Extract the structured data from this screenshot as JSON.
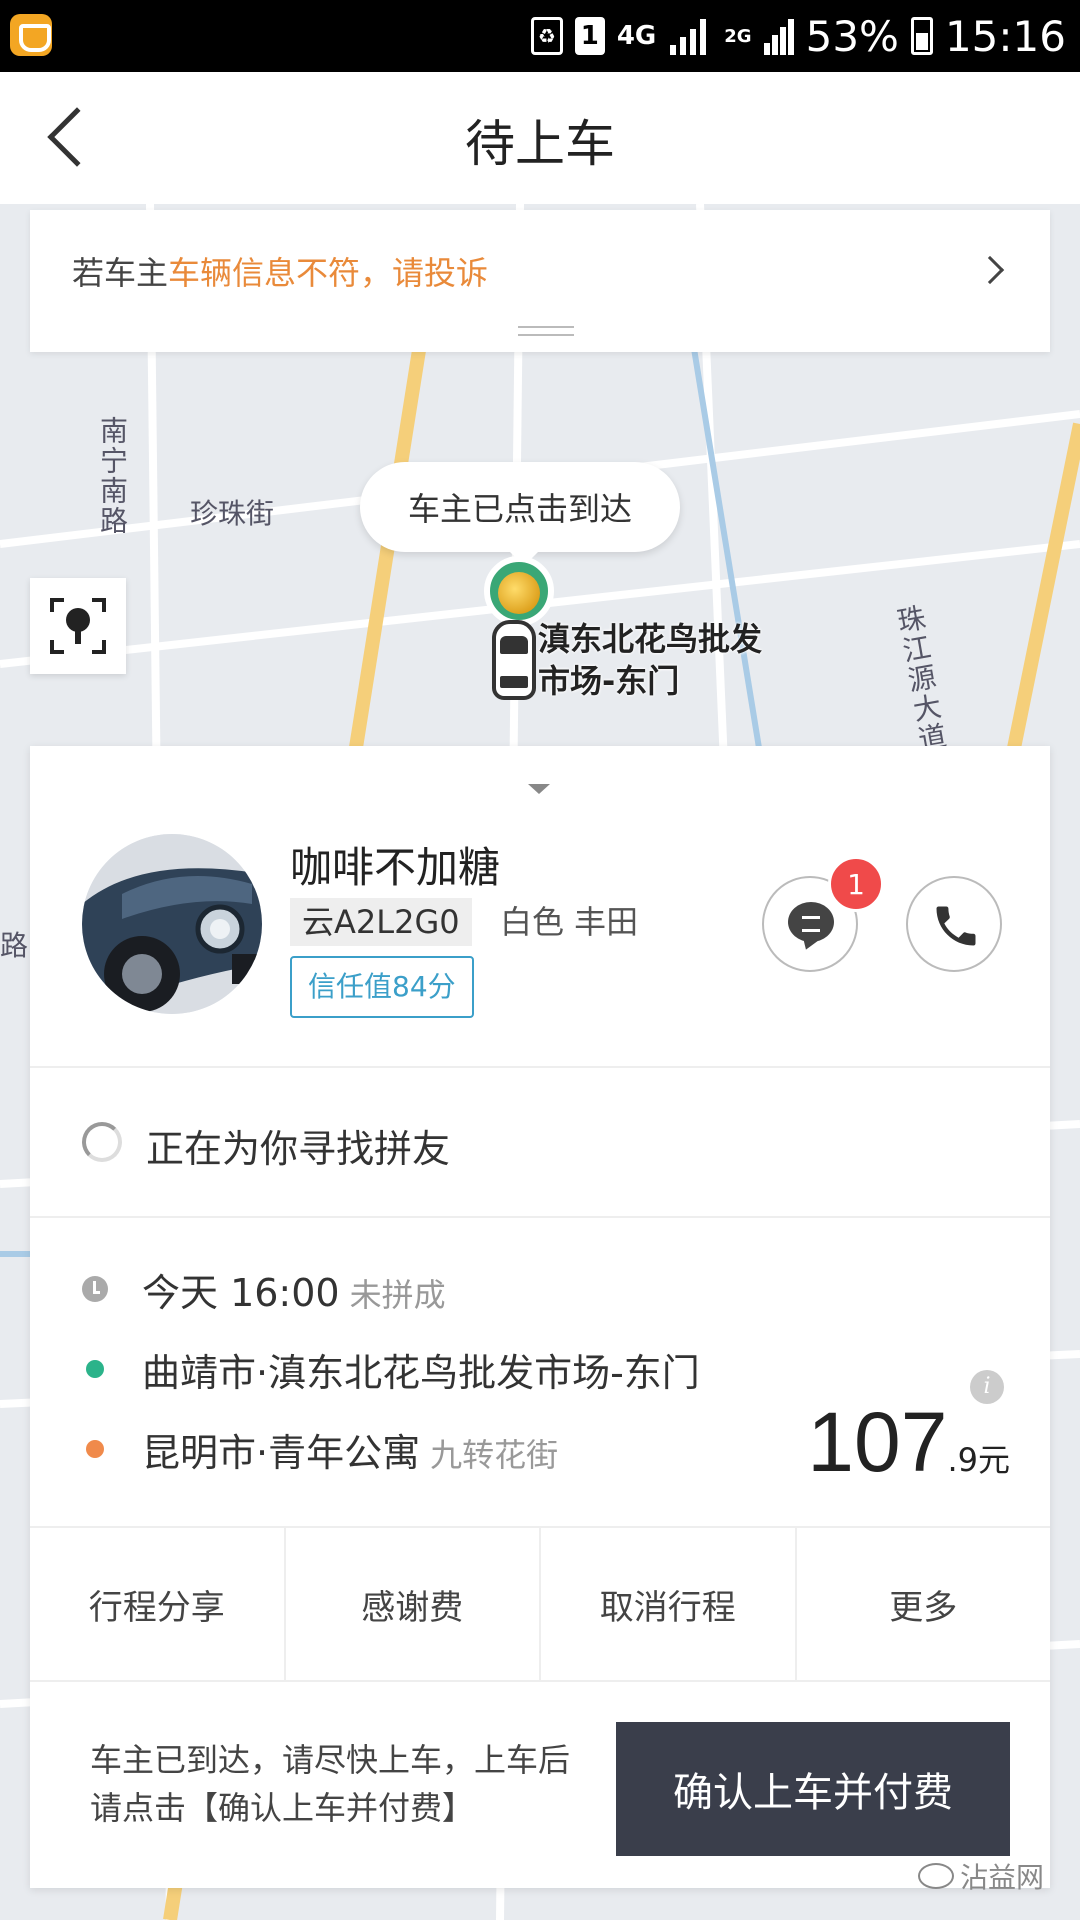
{
  "status_bar": {
    "network": "4G",
    "network2": "2G",
    "sim": "1",
    "battery": "53%",
    "time": "15:16"
  },
  "header": {
    "title": "待上车"
  },
  "complaint": {
    "prefix": "若车主",
    "highlight": "车辆信息不符，请投诉"
  },
  "map": {
    "road_labels": [
      "南宁南路",
      "珍珠街",
      "珠江源大道",
      "路"
    ],
    "bubble": "车主已点击到达",
    "place_label": "滇东北花鸟批发市场-东门"
  },
  "driver": {
    "name": "咖啡不加糖",
    "plate": "云A2L2G0",
    "car_desc": "白色 丰田",
    "trust": "信任值84分",
    "unread_count": "1"
  },
  "search_status": "正在为你寻找拼友",
  "trip": {
    "time": "今天 16:00",
    "time_status": "未拼成",
    "origin": "曲靖市·滇东北花鸟批发市场-东门",
    "destination": "昆明市·青年公寓",
    "destination_sub": "九转花街",
    "fare_int": "107",
    "fare_dec": ".9元"
  },
  "actions": [
    "行程分享",
    "感谢费",
    "取消行程",
    "更多"
  ],
  "bottom": {
    "hint": "车主已到达，请尽快上车，上车后请点击【确认上车并付费】",
    "confirm_label": "确认上车并付费"
  },
  "watermark": "沾益网",
  "colors": {
    "accent_orange": "#e98a3a",
    "origin_dot": "#2bb38a",
    "destination_dot": "#f08a4b",
    "trust_blue": "#3b9fc9",
    "badge_red": "#f04a4a",
    "confirm_bg": "#3a3e4b"
  }
}
